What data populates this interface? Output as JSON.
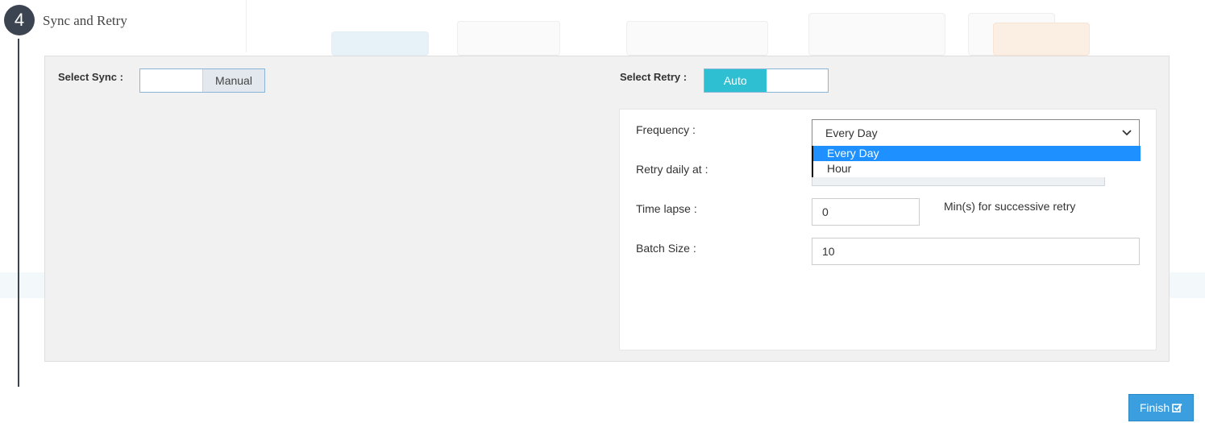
{
  "step": {
    "number": "4",
    "title": "Sync and Retry"
  },
  "sync": {
    "label": "Select Sync :",
    "toggle_off": "",
    "toggle_on": "Manual"
  },
  "retry": {
    "label": "Select Retry :",
    "toggle_on": "Auto",
    "toggle_off": "",
    "frequency_label": "Frequency :",
    "frequency_value": "Every Day",
    "frequency_options": [
      "Every Day",
      "Hour"
    ],
    "retry_daily_at_label": "Retry daily at :",
    "time_lapse_label": "Time lapse :",
    "time_lapse_value": "0",
    "time_lapse_hint": "Min(s) for successive retry",
    "batch_size_label": "Batch Size :",
    "batch_size_value": "10"
  },
  "footer": {
    "finish_label": "Finish"
  },
  "colors": {
    "accent": "#2fbfd3",
    "primary_button": "#3b9ede",
    "dropdown_highlight": "#1e90ff",
    "step_badge": "#3d4451"
  }
}
